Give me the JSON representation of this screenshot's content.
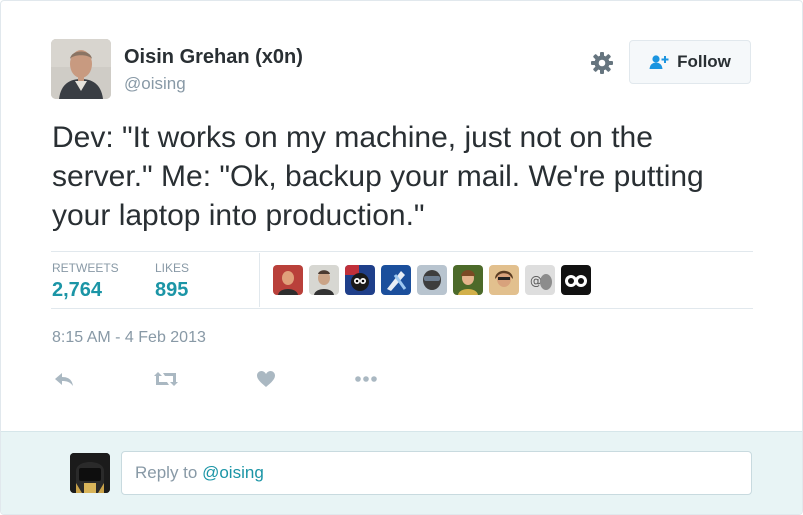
{
  "author": {
    "full_name": "Oisin Grehan (x0n)",
    "handle": "@oising"
  },
  "header": {
    "follow_label": "Follow",
    "settings_icon": "gear-icon",
    "follow_icon": "add-person-icon"
  },
  "tweet": {
    "text": "Dev: \"It works on my machine, just not on the server.\" Me: \"Ok, backup your mail. We're putting your laptop into production.\"",
    "timestamp": "8:15 AM - 4 Feb 2013"
  },
  "stats": {
    "retweets_label": "RETWEETS",
    "retweets_count": "2,764",
    "likes_label": "LIKES",
    "likes_count": "895"
  },
  "likers": {
    "count_shown": 9
  },
  "actions": [
    {
      "name": "reply",
      "icon": "reply-icon"
    },
    {
      "name": "retweet",
      "icon": "retweet-icon"
    },
    {
      "name": "like",
      "icon": "heart-icon"
    },
    {
      "name": "more",
      "icon": "more-icon"
    }
  ],
  "reply": {
    "prefix": "Reply to ",
    "mention": "@oising"
  },
  "colors": {
    "accent": "#1b95a6",
    "muted": "#8899a6",
    "text": "#292f33",
    "reply_bg": "#e8f4f5"
  }
}
